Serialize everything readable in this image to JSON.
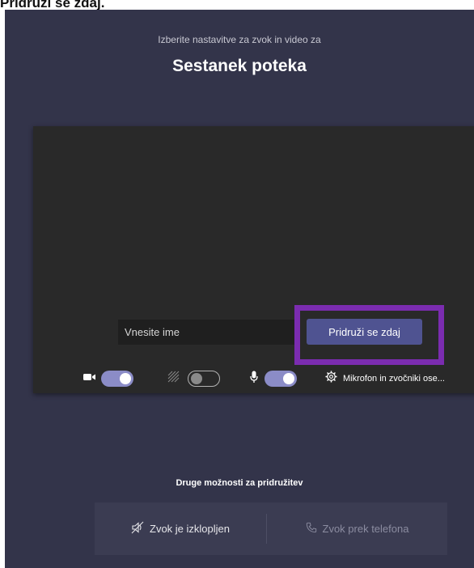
{
  "caption": "Pridruži se zdaj.",
  "header": {
    "subtitle": "Izberite nastavitve za zvok in video za",
    "title": "Sestanek poteka"
  },
  "join": {
    "name_placeholder": "Vnesite ime",
    "join_button_label": "Pridruži se zdaj",
    "highlight_color": "#7b2cb0"
  },
  "controls": {
    "camera": {
      "icon": "camera-icon",
      "state": "on"
    },
    "background_blur": {
      "icon": "blur-icon",
      "state": "off"
    },
    "microphone": {
      "icon": "microphone-icon",
      "state": "on"
    },
    "devices": {
      "icon": "gear-icon",
      "label": "Mikrofon in zvočniki ose..."
    }
  },
  "other_options": {
    "label": "Druge možnosti za pridružitev",
    "audio_off_label": "Zvok je izklopljen",
    "phone_audio_label": "Zvok prek telefona"
  },
  "colors": {
    "background": "#33344a",
    "preview": "#292929",
    "accent": "#4f5391",
    "toggle_on": "#8b8cc7"
  }
}
